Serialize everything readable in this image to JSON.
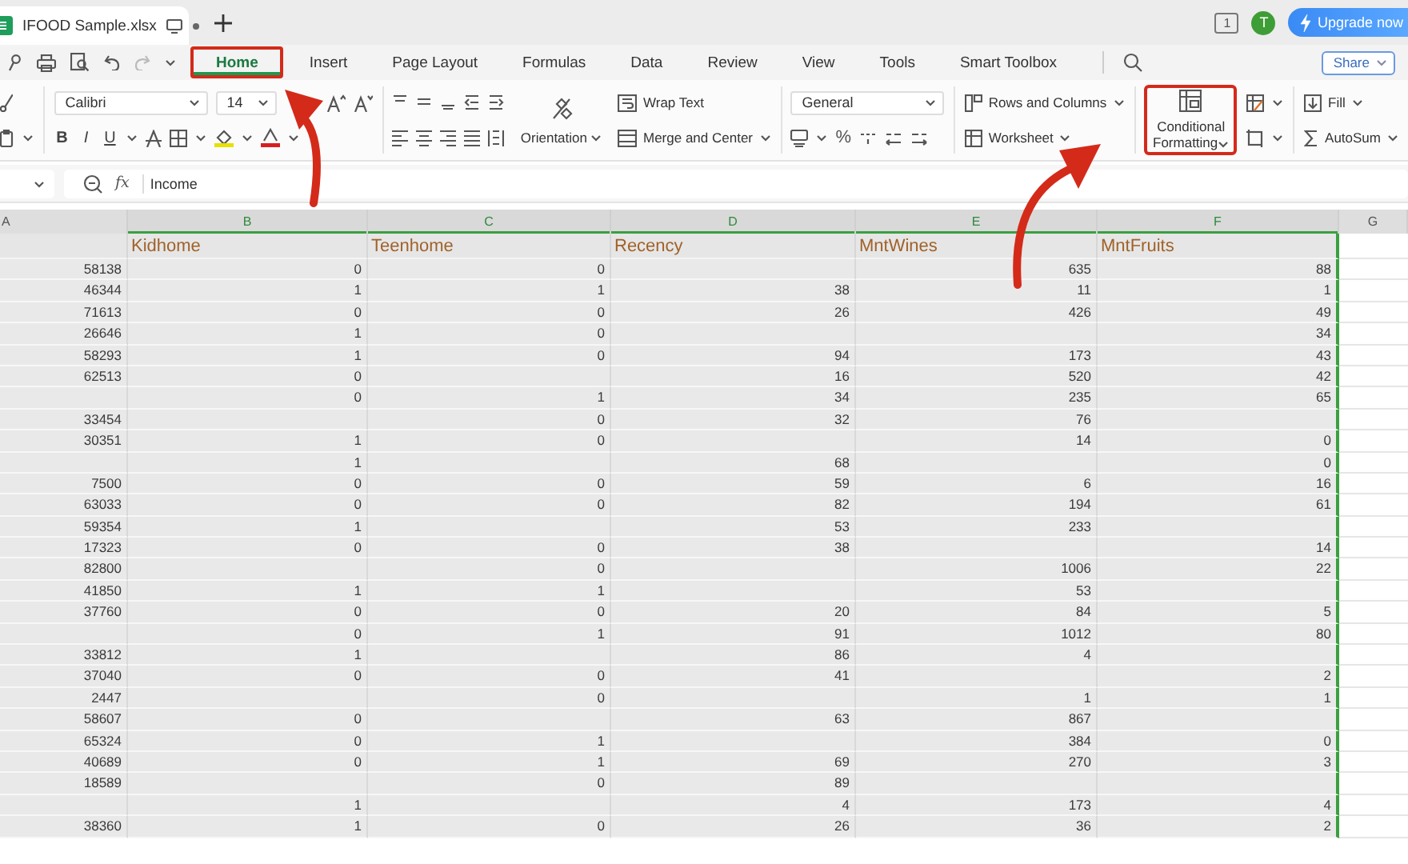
{
  "document_tab": {
    "title": "IFOOD Sample.xlsx"
  },
  "notification_count": "1",
  "account": {
    "initial": "T"
  },
  "upgrade_button": "Upgrade now",
  "tabs": [
    {
      "label": "Home",
      "selected": true,
      "highlighted": true
    },
    {
      "label": "Insert",
      "selected": false,
      "highlighted": false
    },
    {
      "label": "Page Layout",
      "selected": false,
      "highlighted": false
    },
    {
      "label": "Formulas",
      "selected": false,
      "highlighted": false
    },
    {
      "label": "Data",
      "selected": false,
      "highlighted": false
    },
    {
      "label": "Review",
      "selected": false,
      "highlighted": false
    },
    {
      "label": "View",
      "selected": false,
      "highlighted": false
    },
    {
      "label": "Tools",
      "selected": false,
      "highlighted": false
    },
    {
      "label": "Smart Toolbox",
      "selected": false,
      "highlighted": false
    }
  ],
  "share_button": "Share",
  "ribbon": {
    "font_name": "Calibri",
    "font_size": "14",
    "style_buttons": [
      "B",
      "I",
      "U"
    ],
    "wrap_text": "Wrap Text",
    "orientation": "Orientation",
    "merge": "Merge and Center",
    "number_format": "General",
    "percent": "%",
    "rows_columns": "Rows and Columns",
    "worksheet": "Worksheet",
    "conditional_formatting": {
      "label": "Conditional Formatting",
      "highlighted": true
    },
    "fill": "Fill",
    "autosum": "AutoSum"
  },
  "formula_bar": {
    "function_label": "fx",
    "value": "Income"
  },
  "columns": [
    {
      "letter": "A",
      "selected": false
    },
    {
      "letter": "B",
      "heading": "Kidhome",
      "selected": true
    },
    {
      "letter": "C",
      "heading": "Teenhome",
      "selected": true
    },
    {
      "letter": "D",
      "heading": "Recency",
      "selected": true
    },
    {
      "letter": "E",
      "heading": "MntWines",
      "selected": true
    },
    {
      "letter": "F",
      "heading": "MntFruits",
      "selected": true
    },
    {
      "letter": "G",
      "selected": false
    }
  ],
  "rows": [
    {
      "A": "58138",
      "B": "0",
      "C": "0",
      "E": "635",
      "F": "88"
    },
    {
      "A": "46344",
      "B": "1",
      "C": "1",
      "D": "38",
      "E": "11",
      "F": "1"
    },
    {
      "A": "71613",
      "B": "0",
      "C": "0",
      "D": "26",
      "E": "426",
      "F": "49"
    },
    {
      "A": "26646",
      "B": "1",
      "C": "0",
      "F": "34"
    },
    {
      "A": "58293",
      "B": "1",
      "C": "0",
      "D": "94",
      "E": "173",
      "F": "43"
    },
    {
      "A": "62513",
      "B": "0",
      "D": "16",
      "E": "520",
      "F": "42"
    },
    {
      "B": "0",
      "C": "1",
      "D": "34",
      "E": "235",
      "F": "65"
    },
    {
      "A": "33454",
      "C": "0",
      "D": "32",
      "E": "76"
    },
    {
      "A": "30351",
      "B": "1",
      "C": "0",
      "E": "14",
      "F": "0"
    },
    {
      "B": "1",
      "D": "68",
      "F": "0"
    },
    {
      "A": "7500",
      "B": "0",
      "C": "0",
      "D": "59",
      "E": "6",
      "F": "16"
    },
    {
      "A": "63033",
      "B": "0",
      "C": "0",
      "D": "82",
      "E": "194",
      "F": "61"
    },
    {
      "A": "59354",
      "B": "1",
      "D": "53",
      "E": "233"
    },
    {
      "A": "17323",
      "B": "0",
      "C": "0",
      "D": "38",
      "F": "14"
    },
    {
      "A": "82800",
      "C": "0",
      "E": "1006",
      "F": "22"
    },
    {
      "A": "41850",
      "B": "1",
      "C": "1",
      "E": "53"
    },
    {
      "A": "37760",
      "B": "0",
      "C": "0",
      "D": "20",
      "E": "84",
      "F": "5"
    },
    {
      "B": "0",
      "C": "1",
      "D": "91",
      "E": "1012",
      "F": "80"
    },
    {
      "A": "33812",
      "B": "1",
      "D": "86",
      "E": "4"
    },
    {
      "A": "37040",
      "B": "0",
      "C": "0",
      "D": "41",
      "F": "2"
    },
    {
      "A": "2447",
      "C": "0",
      "E": "1",
      "F": "1"
    },
    {
      "A": "58607",
      "B": "0",
      "D": "63",
      "E": "867"
    },
    {
      "A": "65324",
      "B": "0",
      "C": "1",
      "E": "384",
      "F": "0"
    },
    {
      "A": "40689",
      "B": "0",
      "C": "1",
      "D": "69",
      "E": "270",
      "F": "3"
    },
    {
      "A": "18589",
      "C": "0",
      "D": "89"
    },
    {
      "B": "1",
      "D": "4",
      "E": "173",
      "F": "4"
    },
    {
      "A": "38360",
      "B": "1",
      "C": "0",
      "D": "26",
      "E": "36",
      "F": "2"
    }
  ]
}
